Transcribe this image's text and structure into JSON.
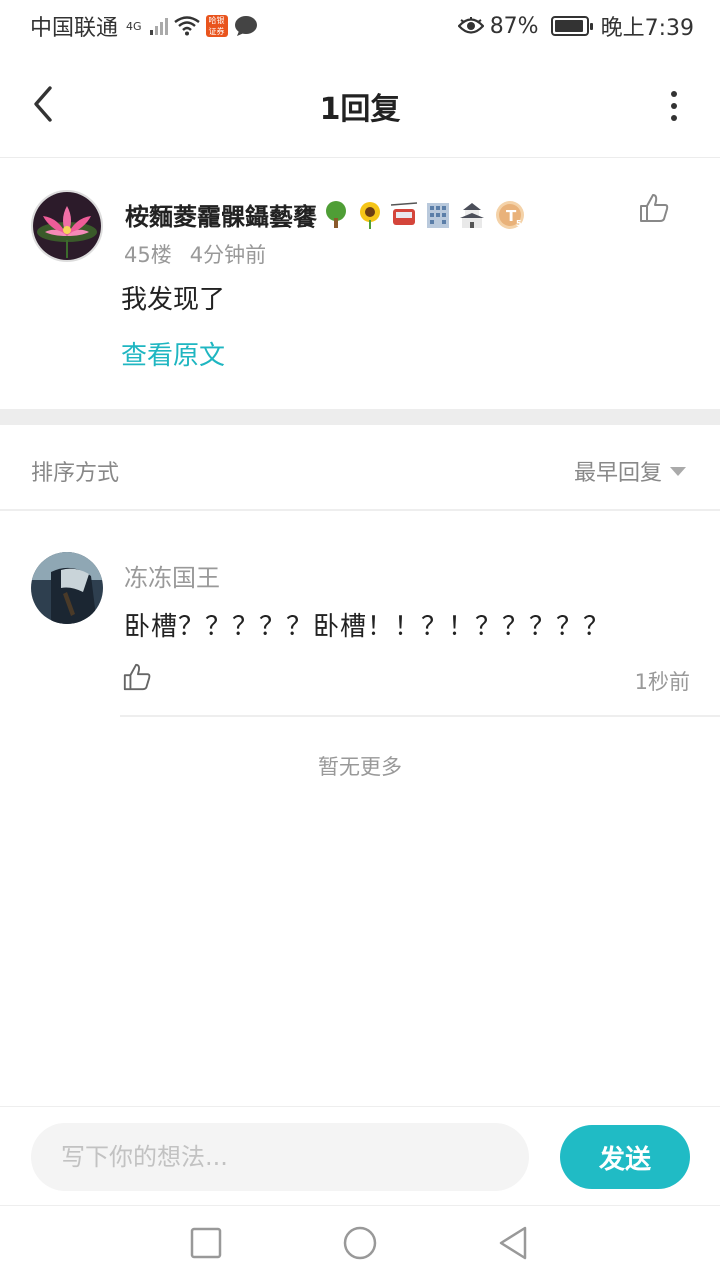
{
  "status_bar": {
    "carrier": "中国联通",
    "network": "4G",
    "app_badge": "哈银证券",
    "battery": "87%",
    "time": "晚上7:39"
  },
  "header": {
    "title": "1回复"
  },
  "post": {
    "author": "桉麵菱靇髁鑷藝饔",
    "author_emojis": [
      "tree-icon",
      "sunflower-icon",
      "aerial-tramway-icon",
      "office-building-icon",
      "castle-icon",
      "level-badge-icon"
    ],
    "level_badge": "T5",
    "floor": "45楼",
    "time_ago": "4分钟前",
    "content": "我发现了",
    "view_original": "查看原文"
  },
  "sort": {
    "label": "排序方式",
    "selected": "最早回复"
  },
  "replies": [
    {
      "author": "冻冻国王",
      "content": "卧槽？？？？？卧槽！！？！？？？？？",
      "time_ago": "1秒前"
    }
  ],
  "no_more": "暂无更多",
  "input": {
    "placeholder": "写下你的想法...",
    "send_label": "发送"
  },
  "colors": {
    "accent": "#20bbc5",
    "link": "#1fb6c1",
    "band": "#ededed"
  }
}
